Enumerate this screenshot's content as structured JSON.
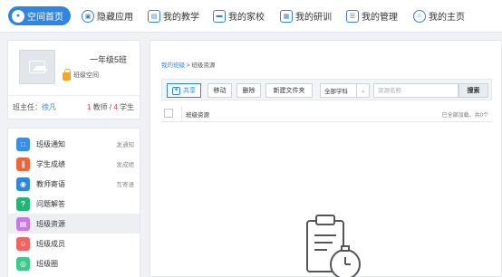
{
  "nav": {
    "items": [
      {
        "label": "空间首页",
        "icon": "user-icon",
        "active": true
      },
      {
        "label": "隐藏应用",
        "icon": "app-icon",
        "active": false
      },
      {
        "label": "我的教学",
        "icon": "teaching-icon",
        "active": false
      },
      {
        "label": "我的家校",
        "icon": "home-school-icon",
        "active": false
      },
      {
        "label": "我的研训",
        "icon": "training-icon",
        "active": false
      },
      {
        "label": "我的管理",
        "icon": "management-icon",
        "active": false
      },
      {
        "label": "我的主页",
        "icon": "homepage-icon",
        "active": false
      }
    ],
    "accent": "#2f86e0"
  },
  "profile": {
    "class_name": "一年级5班",
    "class_space": "班级空间",
    "head_teacher_label": "班主任：",
    "head_teacher_name": "徐凡",
    "teacher_count": "1",
    "teacher_label": "教师 / ",
    "student_count": "4",
    "student_label": "学生"
  },
  "menu": {
    "items": [
      {
        "label": "班级通知",
        "action": "发通知",
        "icon": "notice-icon",
        "color": "#3a8ee6"
      },
      {
        "label": "学生成绩",
        "action": "发成绩",
        "icon": "chart-icon",
        "color": "#f0643c"
      },
      {
        "label": "教师寄语",
        "action": "写寄语",
        "icon": "message-icon",
        "color": "#2f86e0"
      },
      {
        "label": "问题解答",
        "action": "",
        "icon": "question-icon",
        "color": "#22b573"
      },
      {
        "label": "班级资源",
        "action": "",
        "icon": "resource-icon",
        "color": "#c878e6",
        "active": true
      },
      {
        "label": "班级成员",
        "action": "",
        "icon": "members-icon",
        "color": "#f06464"
      },
      {
        "label": "班级圈",
        "action": "",
        "icon": "circle-icon",
        "color": "#3ec98c"
      }
    ]
  },
  "content": {
    "breadcrumb_link": "我的班级",
    "breadcrumb_sep": " > ",
    "breadcrumb_current": "班级资源",
    "toolbar": {
      "share": "共享",
      "move": "移动",
      "delete": "删除",
      "new_folder": "新建文件夹",
      "subject": "全部学科",
      "search_placeholder": "资源名称",
      "search_button": "搜索"
    },
    "folder_tab": "班级资源",
    "load_status": "已全部加载，共0个"
  }
}
